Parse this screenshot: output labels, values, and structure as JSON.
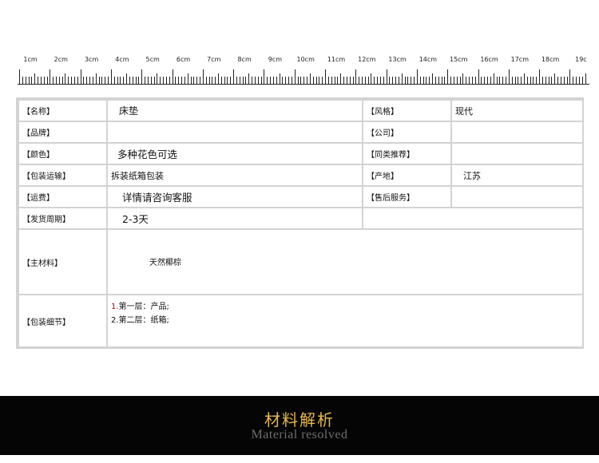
{
  "ruler": {
    "labels": [
      "1cm",
      "2cm",
      "3cm",
      "4cm",
      "5cm",
      "6cm",
      "7cm",
      "8cm",
      "9cm",
      "10cm",
      "11cm",
      "12cm",
      "13cm",
      "14cm",
      "15cm",
      "16cm",
      "17cm",
      "18cm",
      "19c"
    ]
  },
  "spec": {
    "name_label": "【名称】",
    "name_value": "床垫",
    "style_label": "【风格】",
    "style_value": "现代",
    "brand_label": "【品牌】",
    "brand_value": "",
    "company_label": "【公司】",
    "company_value": "",
    "color_label": "【颜色】",
    "color_value": "多种花色可选",
    "similar_label": "【同类推荐】",
    "similar_value": "",
    "transport_label": "【包装运输】",
    "transport_value": "拆装纸箱包装",
    "origin_label": "【产地】",
    "origin_value": "江苏",
    "freight_label": "【运费】",
    "freight_value": "详情请咨询客服",
    "aftersale_label": "【售后服务】",
    "aftersale_value": "",
    "delivery_label": "【发货周期】",
    "delivery_value": "2-3天",
    "material_label": "【主材料】",
    "material_value": "天然椰棕",
    "packing_label": "【包装细节】",
    "packing_line1_num": "1.",
    "packing_line1_text": "第一层：产品;",
    "packing_line2_text": "2.第二层：纸箱;"
  },
  "banner": {
    "title_cn": "材料解析",
    "title_en": "Material resolved"
  }
}
